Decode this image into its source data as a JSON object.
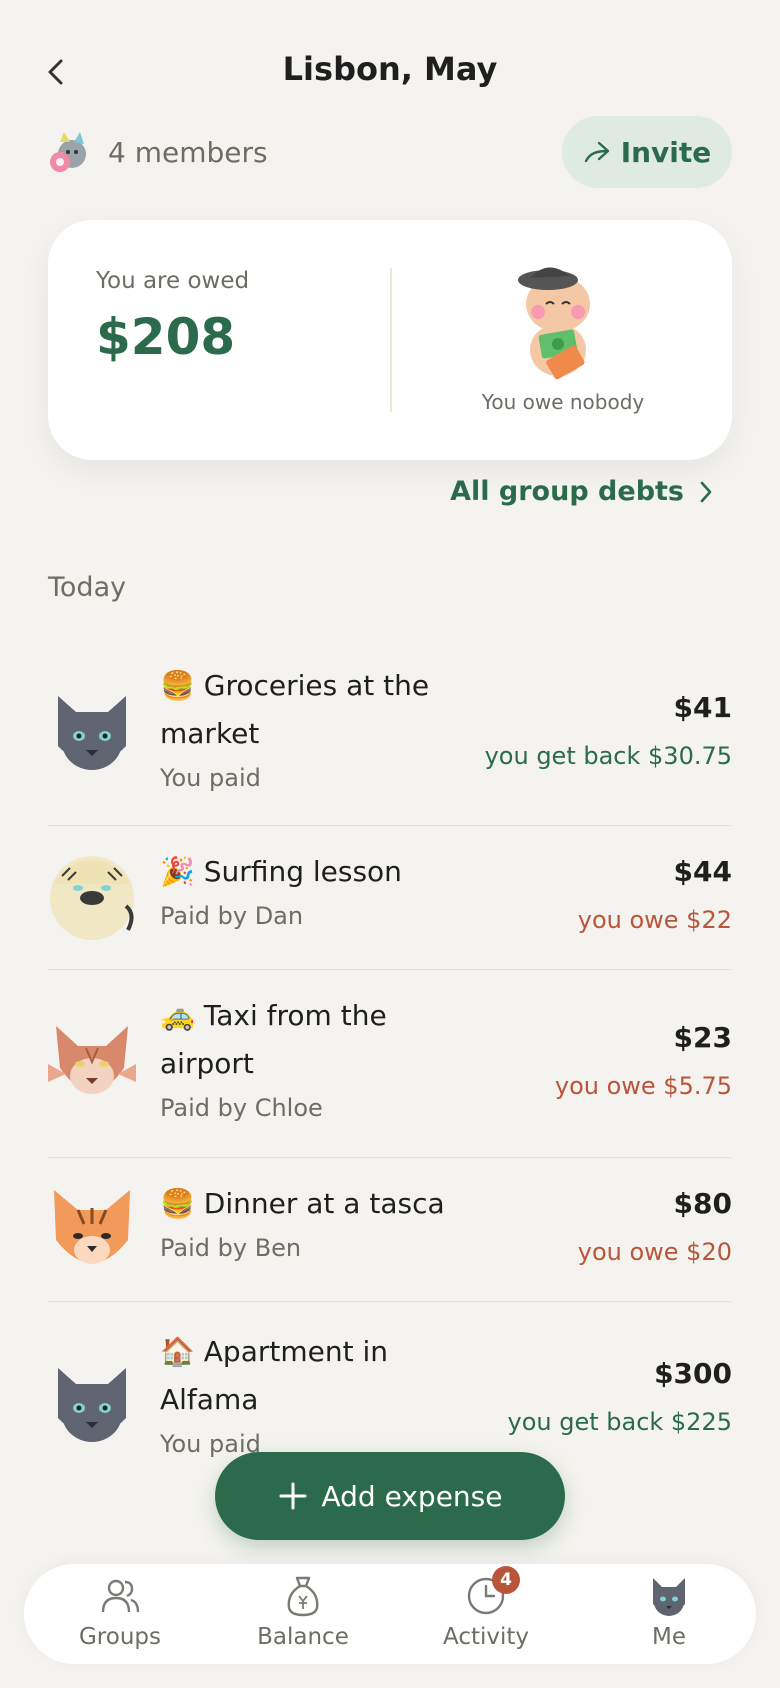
{
  "header": {
    "title": "Lisbon, May"
  },
  "group": {
    "members_label": "4 members",
    "invite_label": "Invite"
  },
  "summary": {
    "owed_label": "You are owed",
    "owed_amount": "$208",
    "owe_label": "You owe nobody"
  },
  "debts_link": "All group debts",
  "section": "Today",
  "expenses": [
    {
      "emoji": "🍔",
      "title_line1": "Groceries at the",
      "title_line2": "market",
      "payer": "You paid",
      "amount": "$41",
      "share": "you get back $30.75",
      "share_type": "get",
      "avatar": "gray-cat-icon"
    },
    {
      "emoji": "🎉",
      "title_line1": "Surfing lesson",
      "title_line2": "",
      "payer": "Paid by Dan",
      "amount": "$44",
      "share": "you owe $22",
      "share_type": "owe",
      "avatar": "cream-cat-icon"
    },
    {
      "emoji": "🚕",
      "title_line1": "Taxi from the",
      "title_line2": "airport",
      "payer": "Paid by Chloe",
      "amount": "$23",
      "share": "you owe $5.75",
      "share_type": "owe",
      "avatar": "lynx-cat-icon"
    },
    {
      "emoji": "🍔",
      "title_line1": "Dinner at a tasca",
      "title_line2": "",
      "payer": "Paid by Ben",
      "amount": "$80",
      "share": "you owe $20",
      "share_type": "owe",
      "avatar": "tiger-cat-icon"
    },
    {
      "emoji": "🏠",
      "title_line1": "Apartment in",
      "title_line2": "Alfama",
      "payer": "You paid",
      "amount": "$300",
      "share": "you get back $225",
      "share_type": "get",
      "avatar": "gray-cat-icon"
    }
  ],
  "add_button": "Add expense",
  "tabs": [
    {
      "label": "Groups",
      "icon": "people-icon"
    },
    {
      "label": "Balance",
      "icon": "money-bag-icon"
    },
    {
      "label": "Activity",
      "icon": "clock-icon",
      "badge": "4"
    },
    {
      "label": "Me",
      "icon": "avatar"
    }
  ],
  "colors": {
    "accent": "#2b6b4b",
    "owe": "#b9553a",
    "background": "#f5f3ef"
  }
}
